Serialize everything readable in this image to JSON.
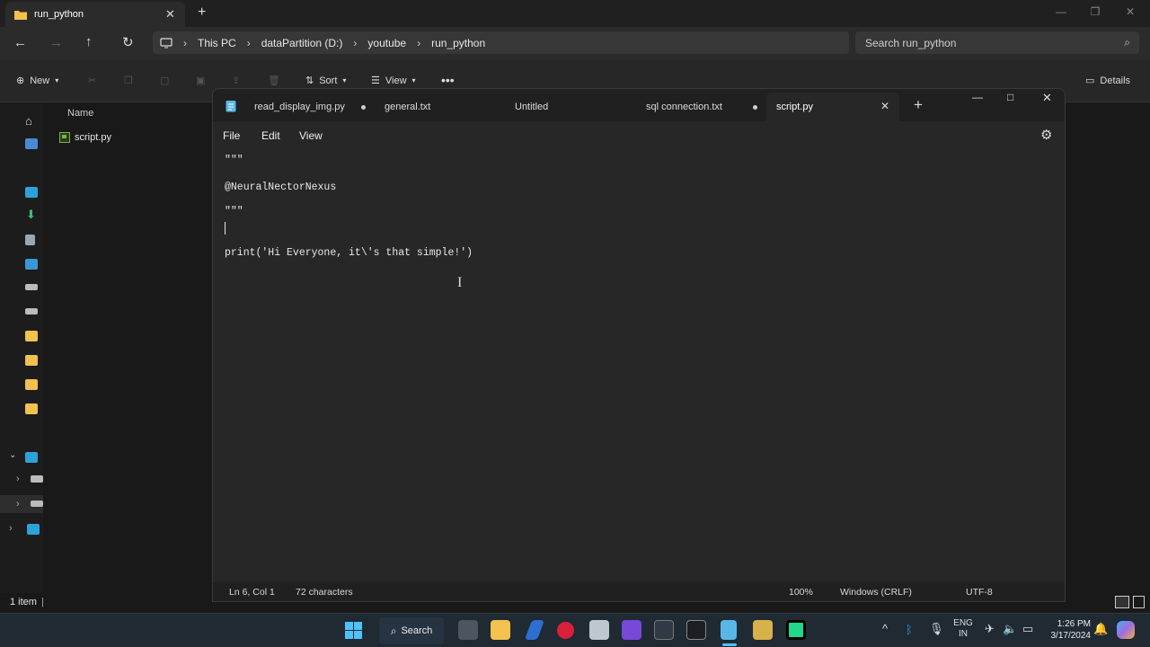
{
  "explorer": {
    "tab_title": "run_python",
    "breadcrumb": [
      "This PC",
      "dataPartition (D:)",
      "youtube",
      "run_python"
    ],
    "search_placeholder": "Search run_python",
    "toolbar": {
      "new_label": "New",
      "sort_label": "Sort",
      "view_label": "View",
      "details_label": "Details"
    },
    "column_name": "Name",
    "files": [
      {
        "name": "script.py",
        "icon": "python-file-icon"
      }
    ],
    "status_count": "1 item"
  },
  "notepad": {
    "tabs": [
      {
        "label": "read_display_img.py",
        "modified": true
      },
      {
        "label": "general.txt",
        "modified": false
      },
      {
        "label": "Untitled",
        "modified": false
      },
      {
        "label": "sql connection.txt",
        "modified": true
      },
      {
        "label": "script.py",
        "active": true
      }
    ],
    "menu": [
      "File",
      "Edit",
      "View"
    ],
    "code_lines": [
      "\"\"\"",
      "@NeuralNectorNexus",
      "\"\"\"",
      "",
      "print('Hi Everyone, it\\'s that simple!')"
    ],
    "status": {
      "position": "Ln 6, Col 1",
      "chars": "72 characters",
      "zoom": "100%",
      "line_ending": "Windows (CRLF)",
      "encoding": "UTF-8"
    }
  },
  "taskbar": {
    "search_label": "Search",
    "lang_top": "ENG",
    "lang_bottom": "IN",
    "time": "1:26 PM",
    "date": "3/17/2024"
  },
  "colors": {
    "accent": "#4cc2ff",
    "folder": "#f2c14e",
    "python_file": "#7cb342",
    "notepad_bg": "#272727"
  }
}
